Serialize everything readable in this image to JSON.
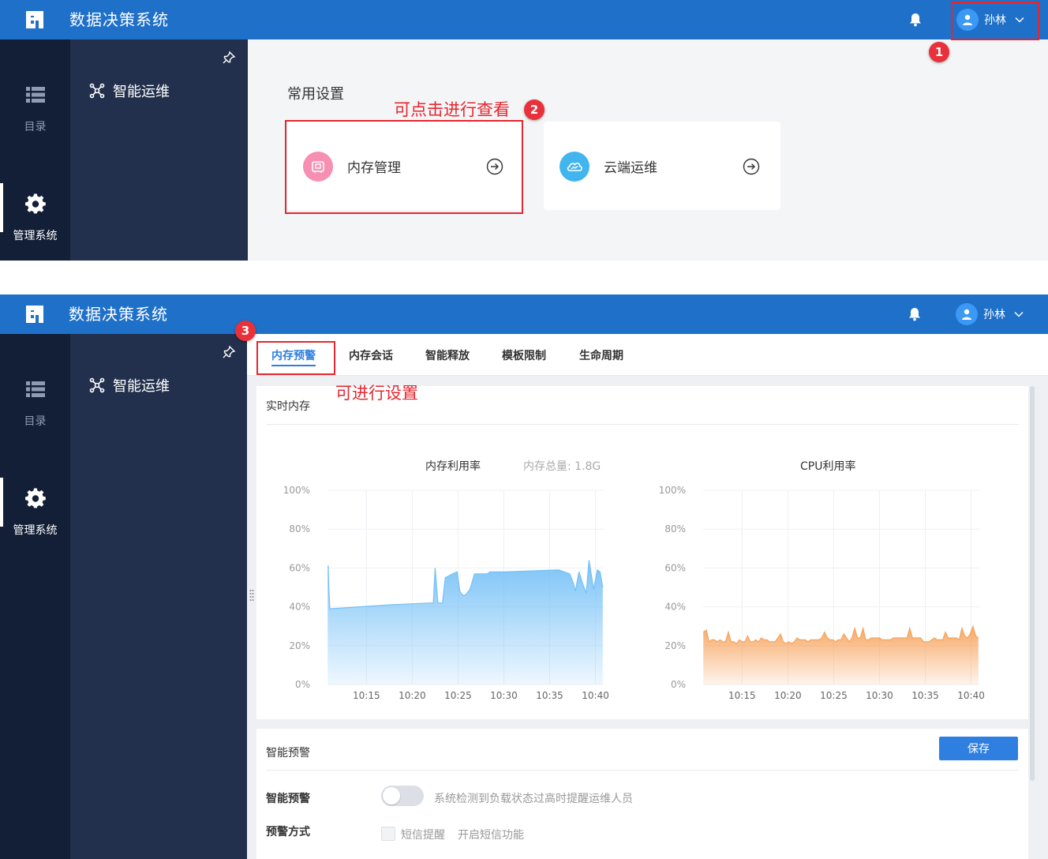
{
  "app": {
    "title": "数据决策系统",
    "user": "孙林",
    "accent": "#1f70c9"
  },
  "rail": {
    "items": [
      {
        "label": "目录",
        "icon": "list-icon"
      },
      {
        "label": "管理系统",
        "icon": "gear-icon"
      }
    ]
  },
  "subnav": {
    "menu_label": "智能运维"
  },
  "screen1": {
    "section_title": "常用设置",
    "cards": [
      {
        "label": "内存管理",
        "icon": "memory-icon",
        "icon_color": "#f78fb3"
      },
      {
        "label": "云端运维",
        "icon": "cloud-icon",
        "icon_color": "#42b4ee"
      }
    ]
  },
  "annotations": {
    "badge1": "1",
    "badge2": "2",
    "badge3": "3",
    "note2": "可点击进行查看",
    "note3": "可进行设置",
    "color": "#e6262e"
  },
  "screen2": {
    "tabs": [
      "内存预警",
      "内存会话",
      "智能释放",
      "模板限制",
      "生命周期"
    ],
    "active_tab": "内存预警",
    "realtime": {
      "title": "实时内存"
    },
    "alert": {
      "title": "智能预警",
      "save_label": "保存",
      "switch_label": "智能预警",
      "switch_hint": "系统检测到负载状态过高时提醒运维人员",
      "switch_on": false,
      "method_label": "预警方式",
      "sms_label": "短信提醒",
      "sms_hint": "开启短信功能",
      "sms_checked": false
    }
  },
  "chart_data": [
    {
      "type": "area",
      "title": "内存利用率",
      "subtitle": "内存总量: 1.8G",
      "color": "#74c0f7",
      "ylim": [
        0,
        100
      ],
      "yticks": [
        "0%",
        "20%",
        "40%",
        "60%",
        "80%",
        "100%"
      ],
      "xticks": [
        "10:15",
        "10:20",
        "10:25",
        "10:30",
        "10:35",
        "10:40"
      ],
      "grid": true,
      "series": [
        {
          "x": [
            10.77,
            10.83,
            10.9,
            11.0,
            17.5,
            22.0,
            22.3,
            22.5,
            22.8,
            23.0,
            23.3,
            23.6,
            24.4,
            24.9,
            25.2,
            25.5,
            25.8,
            26.3,
            26.8,
            27.2,
            27.8,
            28.2,
            28.5,
            29.0,
            30.0,
            36.0,
            37.2,
            37.6,
            37.8,
            38.2,
            38.6,
            39.0,
            39.3,
            39.6,
            39.8,
            40.2,
            40.5,
            40.8
          ],
          "y": [
            61,
            61,
            50,
            39,
            41,
            42,
            42,
            60,
            42,
            42,
            42,
            55,
            57,
            58,
            48,
            46,
            46,
            49,
            57,
            57,
            57,
            57,
            58,
            58,
            58,
            59,
            57,
            52,
            48,
            58,
            52,
            47,
            64,
            55,
            49,
            59,
            58,
            50
          ]
        }
      ]
    },
    {
      "type": "area",
      "title": "CPU利用率",
      "color": "#f7a35c",
      "ylim": [
        0,
        100
      ],
      "yticks": [
        "0%",
        "20%",
        "40%",
        "60%",
        "80%",
        "100%"
      ],
      "xticks": [
        "10:15",
        "10:20",
        "10:25",
        "10:30",
        "10:35",
        "10:40"
      ],
      "grid": true,
      "series": [
        {
          "x": [
            10.77,
            11.1,
            11.4,
            11.7,
            12.0,
            12.3,
            12.6,
            12.9,
            13.2,
            13.5,
            13.8,
            14.1,
            14.4,
            14.7,
            15.0,
            15.3,
            15.6,
            15.9,
            16.2,
            16.5,
            16.8,
            17.1,
            17.4,
            17.7,
            18.0,
            18.3,
            18.6,
            18.9,
            19.2,
            19.5,
            19.8,
            20.1,
            20.4,
            20.7,
            21.0,
            21.3,
            21.6,
            21.9,
            22.2,
            22.5,
            22.8,
            23.1,
            23.4,
            23.7,
            24.0,
            24.3,
            24.6,
            24.9,
            25.2,
            25.5,
            25.8,
            26.1,
            26.4,
            26.7,
            27.0,
            27.3,
            27.6,
            27.9,
            28.2,
            28.5,
            28.8,
            29.1,
            29.4,
            29.7,
            30.0,
            30.3,
            30.6,
            30.9,
            31.2,
            31.5,
            31.8,
            32.1,
            32.4,
            32.7,
            33.0,
            33.3,
            33.6,
            33.9,
            34.2,
            34.5,
            34.8,
            35.1,
            35.4,
            35.7,
            36.0,
            36.3,
            36.6,
            36.9,
            37.2,
            37.5,
            37.8,
            38.1,
            38.4,
            38.7,
            39.0,
            39.3,
            39.6,
            39.9,
            40.2,
            40.5,
            40.8
          ],
          "y": [
            27,
            28,
            22,
            23,
            23,
            22,
            23,
            22,
            22,
            27,
            22,
            22,
            21,
            23,
            22,
            22,
            25,
            22,
            22,
            23,
            22,
            24,
            23,
            23,
            22,
            22,
            22,
            24,
            26,
            22,
            21,
            22,
            21,
            22,
            24,
            23,
            23,
            23,
            22,
            23,
            23,
            23,
            23,
            24,
            27,
            24,
            23,
            23,
            22,
            23,
            23,
            26,
            24,
            22,
            24,
            29,
            24,
            24,
            29,
            23,
            23,
            24,
            24,
            24,
            24,
            23,
            23,
            23,
            23,
            24,
            24,
            24,
            24,
            24,
            24,
            29,
            24,
            24,
            24,
            24,
            22,
            22,
            22,
            23,
            24,
            23,
            23,
            23,
            27,
            24,
            24,
            24,
            24,
            23,
            29,
            25,
            24,
            26,
            30,
            25,
            24
          ]
        }
      ]
    }
  ]
}
